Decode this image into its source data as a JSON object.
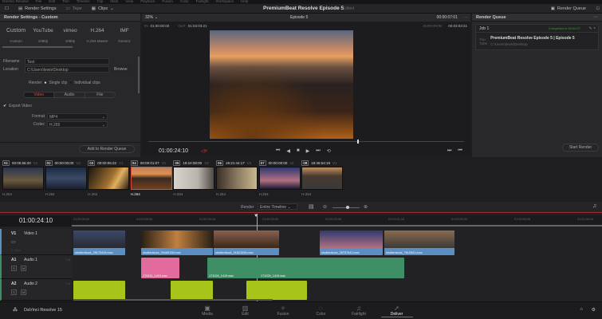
{
  "menu": [
    "DaVinci Resolve",
    "File",
    "Edit",
    "Trim",
    "Timeline",
    "Clip",
    "Mark",
    "View",
    "Playback",
    "Fusion",
    "Color",
    "Fairlight",
    "Workspace",
    "Help"
  ],
  "toolbar": {
    "render_settings": "Render Settings",
    "tape": "Tape",
    "clips": "Clips",
    "project_title": "PremiumBeat Resolve Episode 5",
    "status": "Edited",
    "render_queue": "Render Queue"
  },
  "render_settings": {
    "title": "Render Settings - Custom",
    "presets": [
      {
        "icon": "Custom",
        "label": "Custom"
      },
      {
        "icon": "YouTube",
        "label": "1080p"
      },
      {
        "icon": "vimeo",
        "label": "1080p"
      },
      {
        "icon": "H.264",
        "label": "H.264 Master"
      },
      {
        "icon": "IMF",
        "label": "Generic"
      }
    ],
    "filename_label": "Filename",
    "filename": "Test",
    "location_label": "Location",
    "location": "C:\\Users\\lewis\\Desktop",
    "browse": "Browse",
    "render_label": "Render",
    "single_clip": "Single clip",
    "individual_clips": "Individual clips",
    "tabs": [
      "Video",
      "Audio",
      "File"
    ],
    "export_video": "Export Video",
    "format_label": "Format",
    "format": "MP4",
    "codec_label": "Codec",
    "codec": "H.265",
    "add_queue": "Add to Render Queue"
  },
  "viewer": {
    "zoom": "32%",
    "timeline": "Episode 5",
    "timecode_top": "00:00:07:01",
    "in_label": "IN",
    "in": "01:00:00:00",
    "out_label": "OUT",
    "out": "01:03:03:21",
    "duration_label": "DURATION",
    "duration": "00:03:03:21",
    "timecode": "01:00:24:10"
  },
  "queue": {
    "title": "Render Queue",
    "job": "Job 1",
    "job_status": "Completed in 00:00:07",
    "job_title": "PremiumBeat Resolve Episode 5 | Episode 5",
    "job_path": "C:\\Users\\lewis\\Desktop",
    "start_render": "Start Render"
  },
  "clips": [
    {
      "n": "01",
      "tc": "00:05:56:20",
      "tr": "V1",
      "codec": "H.264",
      "bg": "linear-gradient(#2a3550,#6a5a40 60%,#2a2320)"
    },
    {
      "n": "02",
      "tc": "00:00:00;00",
      "tr": "V2",
      "codec": "H.264",
      "bg": "linear-gradient(#1c2a44,#3a4a66 50%,#1a2030)"
    },
    {
      "n": "03",
      "tc": "00:00:06:22",
      "tr": "V1",
      "codec": "H.264",
      "bg": "linear-gradient(120deg,#1a1510,#a07030 55%,#e0b060 70%,#2a2015)"
    },
    {
      "n": "04",
      "tc": "00:00:01:07",
      "tr": "V1",
      "codec": "H.264",
      "bg": "linear-gradient(#c08060,#e09050 30%,#3a2a20 50%,#704020)"
    },
    {
      "n": "05",
      "tc": "19:24:08:00",
      "tr": "V2",
      "codec": "H.264",
      "bg": "linear-gradient(90deg,#d8d4cc,#b8b4ac 60%,#504a44)"
    },
    {
      "n": "06",
      "tc": "19:21:44:17",
      "tr": "V2",
      "codec": "H.264",
      "bg": "linear-gradient(90deg,#3a3028,#8a7860 50%,#c8b890)"
    },
    {
      "n": "07",
      "tc": "00:00:00:00",
      "tr": "V1",
      "codec": "H.264",
      "bg": "linear-gradient(#303a70,#b07080 60%,#1a1a30)"
    },
    {
      "n": "08",
      "tc": "18:46:54:19",
      "tr": "V1",
      "codec": "H.264",
      "bg": "linear-gradient(#c09060,#4a3a30 40%,#3a3a3a)"
    }
  ],
  "timeline_bar": {
    "render_label": "Render",
    "render_value": "Entire Timeline"
  },
  "timeline": {
    "timecode": "01:00:24:10",
    "ruler": [
      "01:00:00:00",
      "01:00:08:08",
      "01:00:16:16",
      "01:00:25:00",
      "01:00:33:08",
      "01:00:41:16",
      "01:00:50:00",
      "01:00:58:08",
      "01:01:06:16"
    ],
    "tracks": [
      {
        "id": "V1",
        "name": "Video 1",
        "extra": "5 Clips"
      },
      {
        "id": "A1",
        "name": "Audio 1",
        "ch": "2.0"
      },
      {
        "id": "A2",
        "name": "Audio 2",
        "ch": "2.0"
      }
    ],
    "video_clips": [
      "shutterstock_25170419.mov",
      "shutterstock_30469135.mov",
      "shutterstock_31621254.mov",
      "shutterstock_26757642.mov",
      "shutterstock_7612541.mov"
    ],
    "audio_clips": [
      "170411_1410.wav",
      "171024_1419.wav",
      "171024_1419.wav"
    ]
  },
  "bottom": {
    "app": "DaVinci Resolve 15",
    "pages": [
      "Media",
      "Edit",
      "Fusion",
      "Color",
      "Fairlight",
      "Deliver"
    ]
  },
  "colors": {
    "accent": "#e0443a",
    "clip_blue": "#5b8fc4",
    "audio_green": "#3f8f66",
    "audio_pink": "#e36a9c",
    "audio_lime": "#a6c41a"
  }
}
